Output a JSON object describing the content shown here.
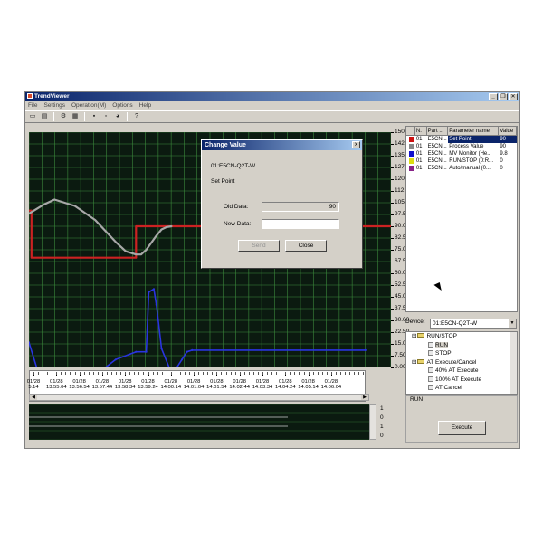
{
  "app": {
    "title": "TrendViewer",
    "window_buttons": [
      "_",
      "❐",
      "✕"
    ]
  },
  "menu": [
    "File",
    "Settings",
    "Operation(M)",
    "Options",
    "Help"
  ],
  "toolbar_icons": [
    "open-icon",
    "save-icon",
    "settings-icon",
    "print-icon",
    "connect-icon",
    "disconnect-icon",
    "color-icon",
    "help-icon"
  ],
  "chart": {
    "yaxis": {
      "min": 0,
      "max": 150,
      "ticks": [
        "150.00",
        "142.50",
        "135.00",
        "127.50",
        "120.00",
        "112.50",
        "105.00",
        "97.50",
        "90.00",
        "82.50",
        "75.00",
        "67.50",
        "60.00",
        "52.50",
        "45.00",
        "37.50",
        "30.00",
        "22.50",
        "15.00",
        "7.50",
        "0.00"
      ]
    },
    "time_labels": [
      [
        "01/28",
        "5:14"
      ],
      [
        "01/28",
        "13:55:04"
      ],
      [
        "01/28",
        "13:56:54"
      ],
      [
        "01/28",
        "13:57:44"
      ],
      [
        "01/28",
        "13:58:34"
      ],
      [
        "01/28",
        "13:59:24"
      ],
      [
        "01/28",
        "14:00:14"
      ],
      [
        "01/28",
        "14:01:04"
      ],
      [
        "01/28",
        "14:01:54"
      ],
      [
        "01/28",
        "14:02:44"
      ],
      [
        "01/28",
        "14:03:34"
      ],
      [
        "01/28",
        "14:04:24"
      ],
      [
        "01/28",
        "14:05:14"
      ],
      [
        "01/28",
        "14:06:04"
      ]
    ],
    "digital_labels": [
      "1",
      "0",
      "1",
      "0"
    ],
    "colors": {
      "background": "#0b1a10",
      "grid": "#3c8a3c",
      "set_point": "#cc2222",
      "process_value": "#a8a8a8",
      "mv_monitor": "#2a34e0"
    }
  },
  "chart_data": {
    "type": "line",
    "title": "",
    "xlabel": "",
    "ylabel": "",
    "ylim": [
      0,
      150
    ],
    "x_range": [
      "13:54:14",
      "14:06:04"
    ],
    "series": [
      {
        "name": "Set Point",
        "x": [
          "13:54:14",
          "13:54:19",
          "13:54:19",
          "13:57:44",
          "13:57:44",
          "14:06:04"
        ],
        "values": [
          100,
          100,
          70,
          70,
          90,
          90
        ]
      },
      {
        "name": "Process Value",
        "x": [
          "13:54:14",
          "13:54:44",
          "13:55:04",
          "13:55:44",
          "13:56:24",
          "13:57:04",
          "13:57:24",
          "13:57:44",
          "13:57:54",
          "13:58:04",
          "13:58:24",
          "13:58:34",
          "13:58:44",
          "13:58:54"
        ],
        "values": [
          98,
          104,
          107,
          103,
          94,
          80,
          74,
          72,
          72,
          75,
          84,
          88,
          89.5,
          90
        ]
      },
      {
        "name": "MV Monitor (Heating)",
        "x": [
          "13:54:14",
          "13:54:29",
          "13:54:49",
          "13:55:54",
          "13:56:44",
          "13:57:04",
          "13:57:44",
          "13:58:04",
          "13:58:09",
          "13:58:19",
          "13:58:24",
          "13:58:34",
          "13:58:49",
          "13:59:04",
          "13:59:14",
          "13:59:24",
          "13:59:34",
          "14:05:14"
        ],
        "values": [
          16,
          0,
          0,
          0,
          0,
          5,
          10,
          10,
          48,
          50,
          40,
          12,
          0,
          0,
          5,
          10,
          11,
          11
        ]
      }
    ]
  },
  "params_table": {
    "headers": [
      "N.",
      "Part ...",
      "Parameter name",
      "Value"
    ],
    "rows": [
      {
        "color": "#cc1111",
        "n": "01",
        "part": "E5CN...",
        "param": "Set Point",
        "value": "90",
        "selected": true
      },
      {
        "color": "#888888",
        "n": "01",
        "part": "E5CN...",
        "param": "Process Value",
        "value": "90",
        "selected": false
      },
      {
        "color": "#1111cc",
        "n": "01",
        "part": "E5CN...",
        "param": "MV Monitor (He...",
        "value": "9.8",
        "selected": false
      },
      {
        "color": "#dddd11",
        "n": "01",
        "part": "E5CN...",
        "param": "RUN/STOP (0:R...",
        "value": "0",
        "selected": false
      },
      {
        "color": "#882288",
        "n": "01",
        "part": "E5CN...",
        "param": "Auto/manual (0...",
        "value": "0",
        "selected": false
      }
    ]
  },
  "device": {
    "label": "Device:",
    "value": "01:E5CN-Q2T-W"
  },
  "tree": {
    "items": [
      {
        "label": "RUN/STOP",
        "type": "folder"
      },
      {
        "label": "RUN",
        "type": "leaf"
      },
      {
        "label": "STOP",
        "type": "leaf"
      },
      {
        "label": "AT Execute/Cancel",
        "type": "folder"
      },
      {
        "label": "40% AT Execute",
        "type": "leaf"
      },
      {
        "label": "100% AT Execute",
        "type": "leaf"
      },
      {
        "label": "AT Cancel",
        "type": "leaf"
      }
    ]
  },
  "run_panel": {
    "label": "RUN",
    "execute_label": "Execute"
  },
  "dialog": {
    "title": "Change Value",
    "device": "01:E5CN-Q2T-W",
    "parameter": "Set Point",
    "old_label": "Old Data:",
    "old_value": "90",
    "new_label": "New Data:",
    "new_value": "",
    "send_label": "Send",
    "close_label": "Close",
    "close_glyph": "x"
  }
}
